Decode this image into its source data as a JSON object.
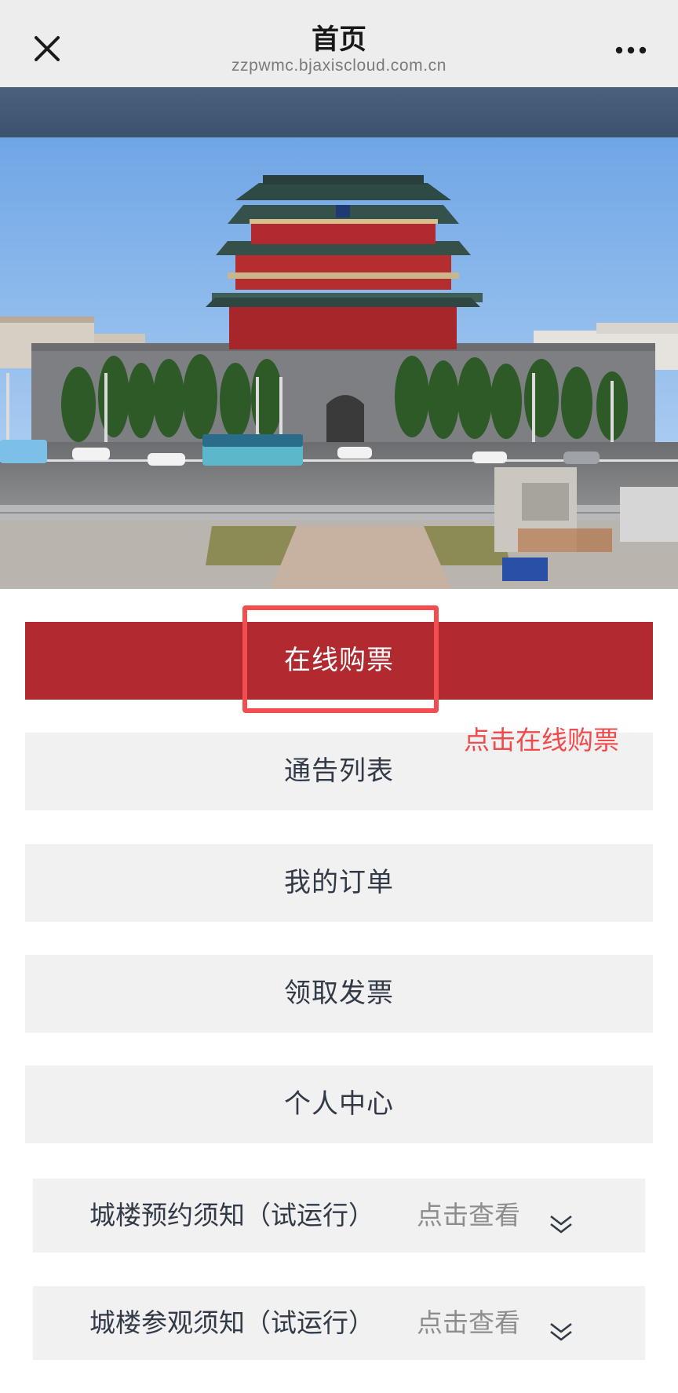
{
  "header": {
    "title": "首页",
    "url": "zzpwmc.bjaxiscloud.com.cn",
    "close_icon": "close-icon",
    "more_icon": "more-dots-icon"
  },
  "hero": {
    "image": "photo of Zhengyangmen archery tower (Beijing) with street and buses"
  },
  "menu": [
    {
      "label": "在线购票"
    },
    {
      "label": "通告列表"
    },
    {
      "label": "我的订单"
    },
    {
      "label": "领取发票"
    },
    {
      "label": "个人中心"
    }
  ],
  "annotation": "点击在线购票",
  "notices": [
    {
      "title": "城楼预约须知（试运行）",
      "action": "点击查看",
      "icon": "chevron-double-down-icon"
    },
    {
      "title": "城楼参观须知（试运行）",
      "action": "点击查看",
      "icon": "chevron-double-down-icon"
    }
  ],
  "colors": {
    "primary": "#b02a30",
    "annotation": "#f04b4c",
    "button_bg": "#f1f1f1",
    "header_bg": "#ededed"
  }
}
